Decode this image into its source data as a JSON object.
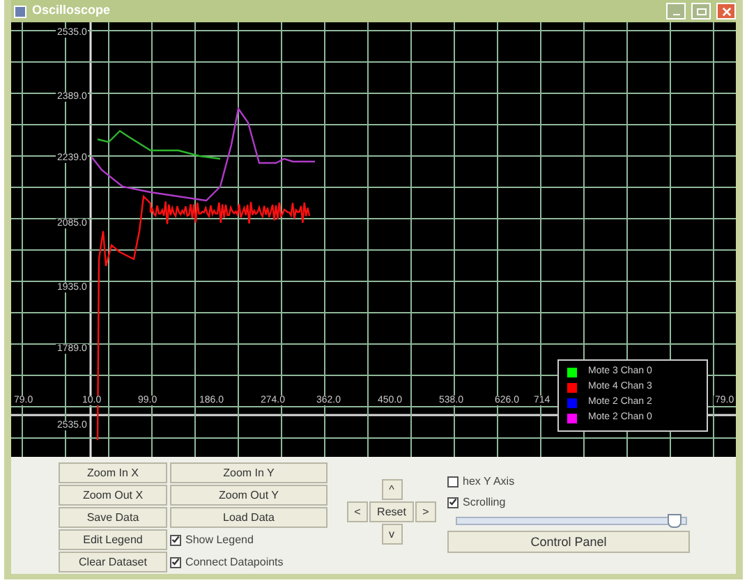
{
  "window": {
    "title": "Oscilloscope"
  },
  "plot": {
    "y_tick_labels": [
      "2535.0",
      "2389.0",
      "2239.0",
      "2085.0",
      "1935.0",
      "1789.0"
    ],
    "origin_label": "2535.0",
    "x_tick_labels": [
      "79.0",
      "10.0",
      "99.0",
      "186.0",
      "274.0",
      "362.0",
      "450.0",
      "538.0",
      "626.0",
      "714",
      "79.0"
    ],
    "legend": [
      {
        "label": "Mote 3 Chan 0",
        "color": "#00ff00"
      },
      {
        "label": "Mote 4 Chan 3",
        "color": "#ff0000"
      },
      {
        "label": "Mote 2 Chan 2",
        "color": "#0000ff"
      },
      {
        "label": "Mote 2 Chan 0",
        "color": "#ff00ff"
      }
    ]
  },
  "buttons_left": [
    "Zoom In X",
    "Zoom Out X",
    "Save Data",
    "Edit Legend",
    "Clear Dataset"
  ],
  "buttons_middle": [
    "Zoom In Y",
    "Zoom Out Y",
    "Load Data"
  ],
  "checkboxes_middle": [
    {
      "label": "Show Legend",
      "checked": true
    },
    {
      "label": "Connect Datapoints",
      "checked": true
    }
  ],
  "nav": {
    "up": "^",
    "left": "<",
    "reset": "Reset",
    "right": ">",
    "down": "v"
  },
  "checkboxes_right": [
    {
      "label": "hex Y Axis",
      "checked": false
    },
    {
      "label": "Scrolling",
      "checked": true
    }
  ],
  "slider": {
    "level": 0.95
  },
  "control_panel_button": "Control Panel"
}
